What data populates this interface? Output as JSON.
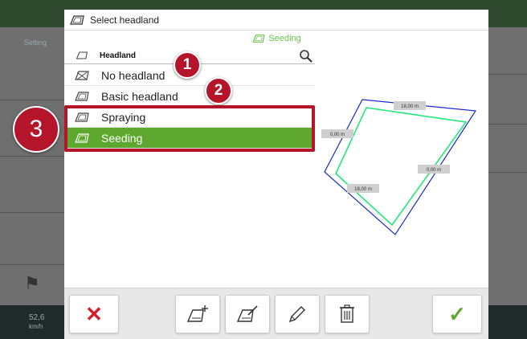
{
  "background": {
    "settings_label": "Setting",
    "bottom_value": "52,6",
    "bottom_unit": "km/h"
  },
  "dialog": {
    "title": "Select headland",
    "subtitle": "Seeding"
  },
  "list": {
    "header": "Headland",
    "items": [
      {
        "label": "No headland",
        "icon": "no-headland-icon"
      },
      {
        "label": "Basic headland",
        "icon": "headland-icon"
      },
      {
        "label": "Spraying",
        "icon": "headland-icon"
      },
      {
        "label": "Seeding",
        "icon": "headland-icon",
        "selected": true
      }
    ]
  },
  "markers": [
    "1",
    "2",
    "3"
  ],
  "map": {
    "labels": [
      "18,00 m",
      "0,00 m",
      "0,00 m",
      "18,00 m"
    ],
    "colors": {
      "field": "#1a2bc8",
      "headland": "#22e87a"
    }
  },
  "toolbar": {
    "cancel_icon": "close-icon",
    "add_icon": "add-headland-icon",
    "edit_headland_icon": "edit-headland-icon",
    "edit_icon": "pencil-icon",
    "delete_icon": "trash-icon",
    "confirm_icon": "check-icon"
  },
  "colors": {
    "accent": "#5ea82f",
    "marker": "#b5152b",
    "cancel": "#d2202a"
  }
}
